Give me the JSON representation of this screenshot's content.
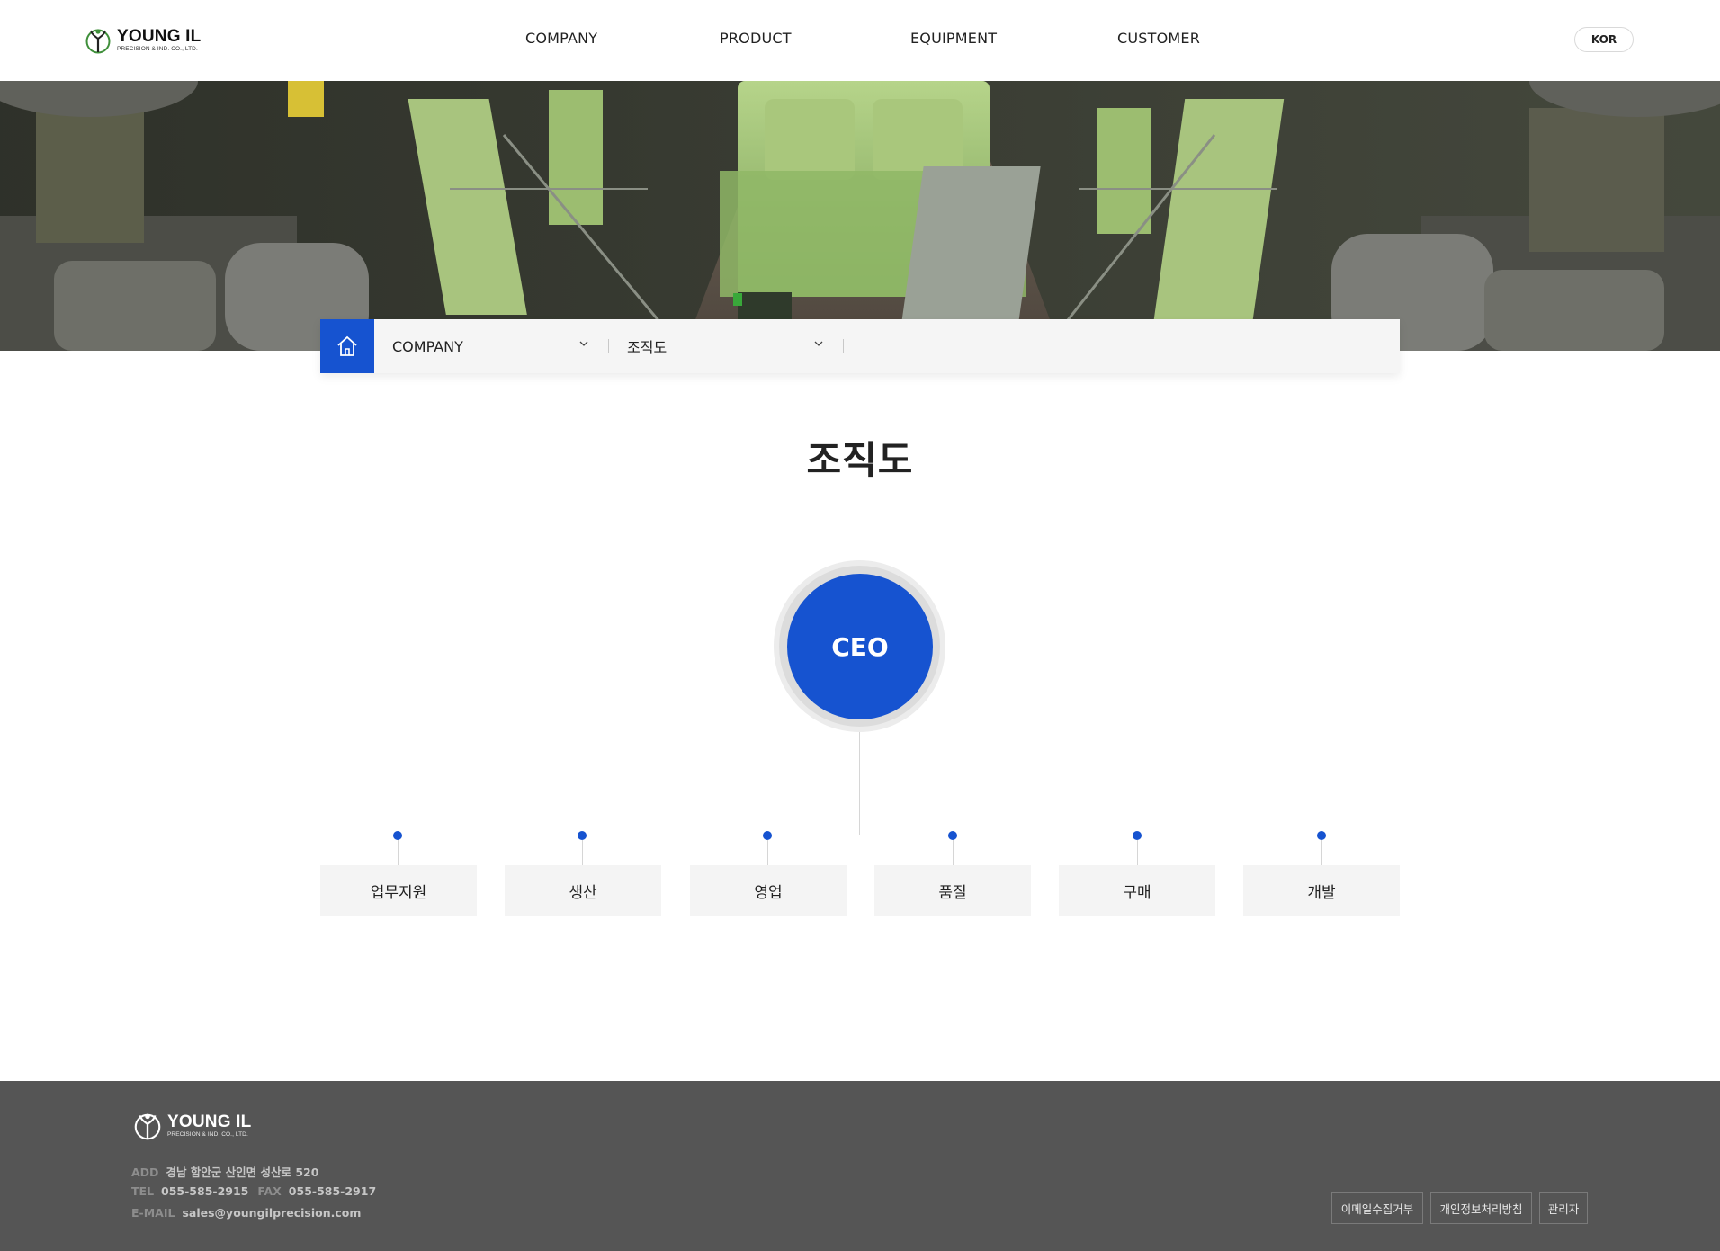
{
  "header": {
    "logo_main": "YOUNG IL",
    "logo_sub": "PRECISION & IND. CO., LTD.",
    "nav": [
      "COMPANY",
      "PRODUCT",
      "EQUIPMENT",
      "CUSTOMER"
    ],
    "lang": "KOR"
  },
  "breadcrumb": {
    "level1": "COMPANY",
    "level2": "조직도"
  },
  "page_title": "조직도",
  "org": {
    "top": "CEO",
    "departments": [
      "업무지원",
      "생산",
      "영업",
      "품질",
      "구매",
      "개발"
    ]
  },
  "footer": {
    "logo_main": "YOUNG IL",
    "logo_sub": "PRECISION & IND. CO., LTD.",
    "add_label": "ADD",
    "add_value": "경남 함안군 산인면 성산로 520",
    "tel_label": "TEL",
    "tel_value": "055-585-2915",
    "fax_label": "FAX",
    "fax_value": "055-585-2917",
    "email_label": "E-MAIL",
    "email_value": "sales@youngilprecision.com",
    "links": [
      "이메일수집거부",
      "개인정보처리방침",
      "관리자"
    ]
  },
  "colors": {
    "accent": "#1653d0",
    "footer_bg": "#555555"
  }
}
